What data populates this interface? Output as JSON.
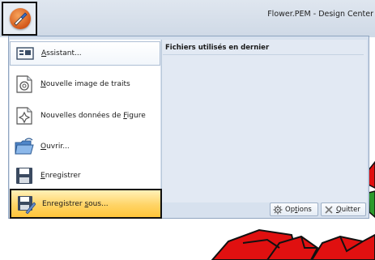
{
  "window": {
    "title": "Flower.PEM - Design Center"
  },
  "app_menu_button": {
    "icon": "brush-orb-icon"
  },
  "menu": {
    "items": [
      {
        "key": "assistant",
        "pre": "",
        "ul": "A",
        "post": "ssistant...",
        "icon": "wizard-icon"
      },
      {
        "key": "new-line-image",
        "pre": "",
        "ul": "N",
        "post": "ouvelle image de traits",
        "icon": "new-line-image-icon"
      },
      {
        "key": "new-figure-data",
        "pre": "Nouvelles données de ",
        "ul": "F",
        "post": "igure",
        "icon": "new-figure-data-icon"
      },
      {
        "key": "open",
        "pre": "",
        "ul": "O",
        "post": "uvrir...",
        "icon": "folder-open-icon"
      },
      {
        "key": "save",
        "pre": "",
        "ul": "E",
        "post": "nregistrer",
        "icon": "floppy-disk-icon"
      },
      {
        "key": "save-as",
        "pre": "Enregistrer ",
        "ul": "s",
        "post": "ous...",
        "icon": "save-as-icon"
      }
    ],
    "recent_title": "Fichiers utilisés en dernier",
    "options_label_pre": "Op",
    "options_label_ul": "t",
    "options_label_post": "ions",
    "quit_label_ul": "Q",
    "quit_label_post": "uitter"
  },
  "colors": {
    "highlight": "#ffd466",
    "pattern_red": "#e01010"
  }
}
